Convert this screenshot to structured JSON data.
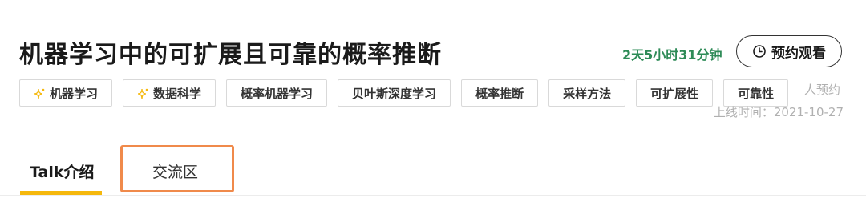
{
  "talk": {
    "title": "机器学习中的可扩展且可靠的概率推断",
    "countdown": "2天5小时31分钟",
    "reserve_button_label": "预约观看",
    "reservation_count": "人预约",
    "online_time": "上线时间：2021-10-27"
  },
  "tags": [
    {
      "label": "机器学习",
      "icon": "sparkle-icon"
    },
    {
      "label": "数据科学",
      "icon": "sparkle-icon"
    },
    {
      "label": "概率机器学习"
    },
    {
      "label": "贝叶斯深度学习"
    },
    {
      "label": "概率推断"
    },
    {
      "label": "采样方法"
    },
    {
      "label": "可扩展性"
    },
    {
      "label": "可靠性"
    }
  ],
  "tabs": [
    {
      "label": "Talk介绍",
      "active": true
    },
    {
      "label": "交流区",
      "active": false
    }
  ],
  "colors": {
    "countdown": "#2e8b57",
    "active_tab_underline": "#f5b80c",
    "highlight_box": "#f08a4b",
    "tag_icon": "#f5b80c"
  }
}
